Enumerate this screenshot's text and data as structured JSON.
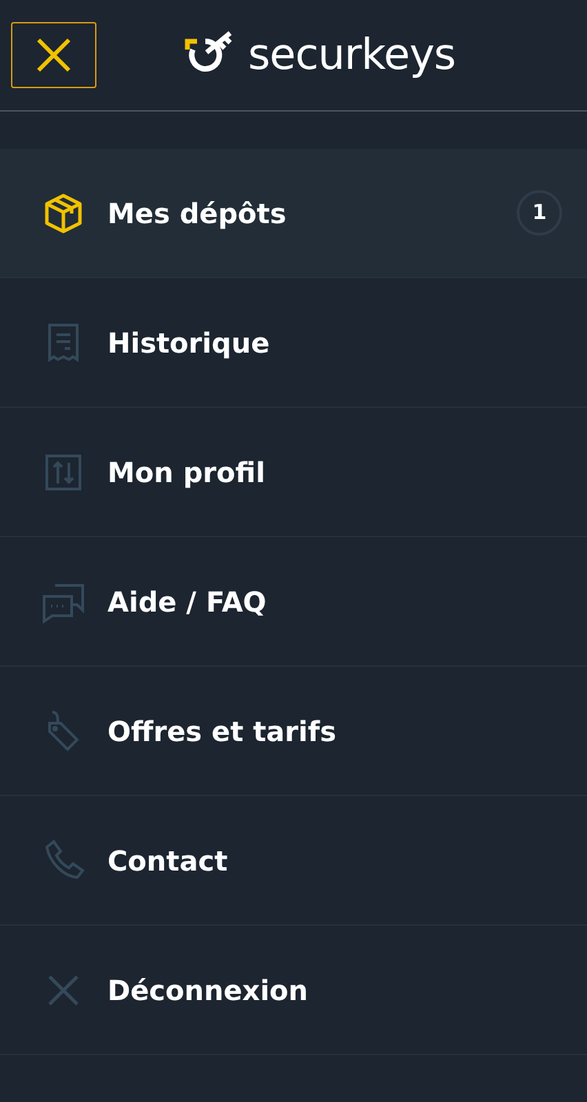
{
  "header": {
    "logo_text": "securkeys"
  },
  "menu": [
    {
      "label": "Mes dépôts",
      "selected": true,
      "badge": "1"
    },
    {
      "label": "Historique",
      "selected": false
    },
    {
      "label": "Mon profil",
      "selected": false
    },
    {
      "label": "Aide / FAQ",
      "selected": false
    },
    {
      "label": "Offres et tarifs",
      "selected": false
    },
    {
      "label": "Contact",
      "selected": false
    },
    {
      "label": "Déconnexion",
      "selected": false
    }
  ]
}
